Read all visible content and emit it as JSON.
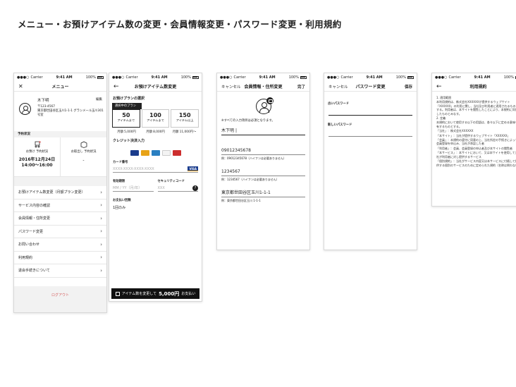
{
  "page_title": "メニュー・お預けアイテム数の変更・会員情報変更・パスワード変更・利用規約",
  "status_bar": {
    "carrier": "Carrier",
    "time": "9:41 AM",
    "battery": "100%"
  },
  "menu_screen": {
    "title": "メニュー",
    "edit": "編集",
    "name": "木下明",
    "postal": "〒123-4567",
    "address": "東京都世田谷区玉川1-1-1 グランメール玉川301号室",
    "status_section": "予約状況",
    "pickup_label": "お預け 予約状況",
    "pickup_date": "2016年12月24日",
    "pickup_time": "14:00〜16:00",
    "return_label": "お取出し 予約状況",
    "return_value": "-",
    "items": [
      "お預けアイテム数変更（月額プラン変更）",
      "サービス内容の確認",
      "会員情報・住所変更",
      "パスワード変更",
      "お問い合わせ",
      "利用規約",
      "退会手続きについて"
    ],
    "logout": "ログアウト"
  },
  "plan_screen": {
    "title": "お預けアイテム数変更",
    "plan_section": "お預けプランの選択",
    "current_plan": "選択中のプラン",
    "plans": [
      {
        "count": "50",
        "unit": "アイテムまで",
        "price": "月額 5,000円"
      },
      {
        "count": "100",
        "unit": "アイテムまで",
        "price": "月額 8,000円"
      },
      {
        "count": "150",
        "unit": "アイテム以上",
        "price": "月額 11,000円〜"
      }
    ],
    "card_section": "クレジット決済入力",
    "card_number_label": "カード番号",
    "card_number_placeholder": "XXXX-XXXX-XXXX-XXXX",
    "visa": "VISA",
    "expiry_label": "有効期限",
    "expiry_placeholder": "MM / YY（月/年）",
    "cvc_label": "セキュリティコード",
    "cvc_placeholder": "XXX",
    "help": "?",
    "installments_label": "お支払い回数",
    "installments_value": "1回のみ",
    "cta_prefix": "アイテム数を変更して",
    "cta_amount": "5,000円",
    "cta_suffix": "お支払い"
  },
  "member_screen": {
    "cancel": "キャンセル",
    "title": "会員情報・住所変更",
    "done": "完了",
    "required_note": "※すべての入力項目は必須となります。",
    "name_value": "木下明",
    "phone_value": "09012345678",
    "phone_help": "例：09012345678（ハイフンは必要ありません）",
    "postal_value": "1234567",
    "postal_help": "例：1234567（ハイフンは必要ありません）",
    "address_value": "東京都世田谷区玉川1-1-1",
    "address_help": "例：東京都世田谷区玉川 1-1-1"
  },
  "password_screen": {
    "cancel": "キャンセル",
    "title": "パスワード変更",
    "save": "保存",
    "old_label": "古いパスワード",
    "new_label": "新しいパスワード"
  },
  "terms_screen": {
    "title": "利用規約",
    "lines": [
      "1. 適用範囲",
      "本利用規約は、株式会社XXXXXXが提供するウェブサイト「XXXXXX」の利用に関し、当社及び利用者に適用されるものとする。利用者は、本サイトを閲覧したことにより、本規約に同意したものとみなす。",
      "2. 定義",
      "本規約において使用する以下の用語は、各々以下に定める意味を有するものとする。",
      "「当社」：株式会社XXXXXX",
      "「本サイト」：当社が提供するウェブサイト「XXXXXX」",
      "「会員」：本規約の遵守に同意の上、当社所定の手続きによって会員登録を申込み、当社が承認した者",
      "「利用者」：会員、会員登録の申込者及び本サイトの閲覧者",
      "「本サービス」：本サイトにおいて、又は本サイトを使用して当社が利用者に対し提供するサービス",
      "「個別規約」：当社がサービス内容又は本サービスに付随して提供する個別のサービスのために定められた規約（名称は問わない）"
    ]
  }
}
